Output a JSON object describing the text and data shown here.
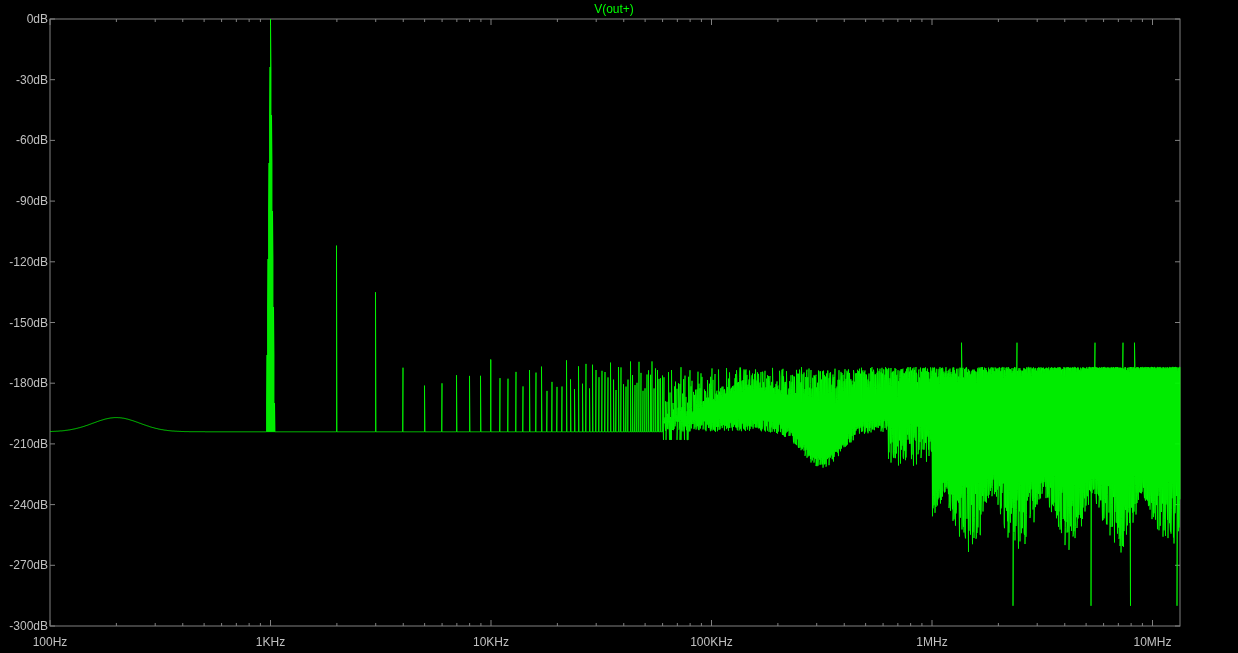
{
  "plot": {
    "title": "V(out+)",
    "y_ticks": [
      "0dB",
      "-30dB",
      "-60dB",
      "-90dB",
      "-120dB",
      "-150dB",
      "-180dB",
      "-210dB",
      "-240dB",
      "-270dB",
      "-300dB"
    ],
    "x_ticks": [
      "100Hz",
      "1KHz",
      "10KHz",
      "100KHz",
      "1MHz",
      "10MHz"
    ]
  }
}
